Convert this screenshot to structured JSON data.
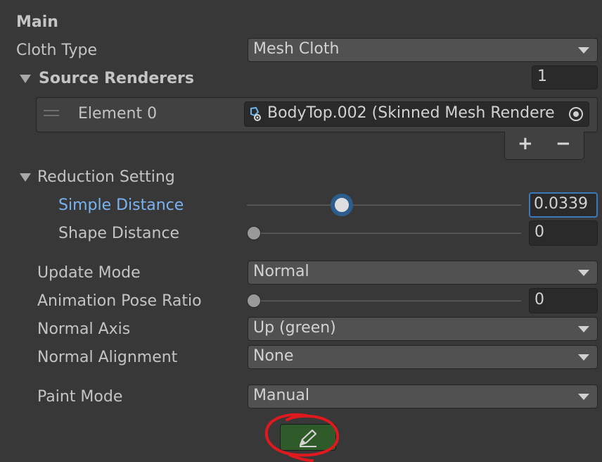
{
  "section_title": "Main",
  "cloth_type": {
    "label": "Cloth Type",
    "value": "Mesh Cloth"
  },
  "source_renderers": {
    "label": "Source Renderers",
    "count": "1",
    "elements": [
      {
        "label": "Element 0",
        "value": "BodyTop.002 (Skinned Mesh Rendere"
      }
    ],
    "add_label": "+",
    "remove_label": "−"
  },
  "reduction": {
    "label": "Reduction Setting",
    "simple_distance": {
      "label": "Simple Distance",
      "value": "0.0339",
      "level": 0.34
    },
    "shape_distance": {
      "label": "Shape Distance",
      "value": "0",
      "level": 0
    }
  },
  "update_mode": {
    "label": "Update Mode",
    "value": "Normal"
  },
  "animation_pose_ratio": {
    "label": "Animation Pose Ratio",
    "value": "0",
    "level": 0
  },
  "normal_axis": {
    "label": "Normal Axis",
    "value": "Up (green)"
  },
  "normal_alignment": {
    "label": "Normal Alignment",
    "value": "None"
  },
  "paint_mode": {
    "label": "Paint Mode",
    "value": "Manual"
  },
  "colors": {
    "background": "#383838",
    "accent": "#3a79bb",
    "highlight_label": "#7ab3f2",
    "paint_button": "#2f5a2a",
    "annotation_circle": "#e0191f"
  },
  "icons": {
    "foldout": "triangle-down-icon",
    "drag_handle": "drag-handle-icon",
    "mesh_renderer": "skinned-mesh-renderer-icon",
    "object_picker": "object-picker-icon",
    "dropdown": "chevron-down-icon",
    "paint": "pencil-icon"
  }
}
